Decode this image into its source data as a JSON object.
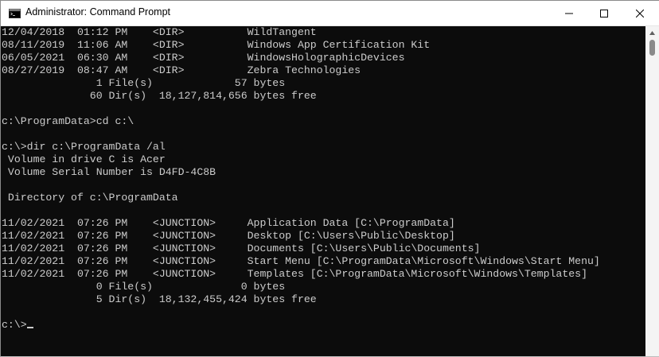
{
  "window": {
    "title": "Administrator: Command Prompt",
    "icon": "cmd-icon",
    "controls": {
      "minimize": "minimize-icon",
      "maximize": "maximize-icon",
      "close": "close-icon"
    }
  },
  "console": {
    "lines": [
      "12/04/2018  01:12 PM    <DIR>          WildTangent",
      "08/11/2019  11:06 AM    <DIR>          Windows App Certification Kit",
      "06/05/2021  06:30 AM    <DIR>          WindowsHolographicDevices",
      "08/27/2019  08:47 AM    <DIR>          Zebra Technologies",
      "               1 File(s)             57 bytes",
      "              60 Dir(s)  18,127,814,656 bytes free",
      "",
      "c:\\ProgramData>cd c:\\",
      "",
      "c:\\>dir c:\\ProgramData /al",
      " Volume in drive C is Acer",
      " Volume Serial Number is D4FD-4C8B",
      "",
      " Directory of c:\\ProgramData",
      "",
      "11/02/2021  07:26 PM    <JUNCTION>     Application Data [C:\\ProgramData]",
      "11/02/2021  07:26 PM    <JUNCTION>     Desktop [C:\\Users\\Public\\Desktop]",
      "11/02/2021  07:26 PM    <JUNCTION>     Documents [C:\\Users\\Public\\Documents]",
      "11/02/2021  07:26 PM    <JUNCTION>     Start Menu [C:\\ProgramData\\Microsoft\\Windows\\Start Menu]",
      "11/02/2021  07:26 PM    <JUNCTION>     Templates [C:\\ProgramData\\Microsoft\\Windows\\Templates]",
      "               0 File(s)              0 bytes",
      "               5 Dir(s)  18,132,455,424 bytes free",
      ""
    ],
    "prompt": "c:\\>"
  },
  "colors": {
    "console_bg": "#0c0c0c",
    "console_fg": "#cccccc",
    "titlebar_bg": "#ffffff",
    "scrollbar_bg": "#f4f4f4",
    "scrollbar_thumb": "#8a8a8a"
  }
}
